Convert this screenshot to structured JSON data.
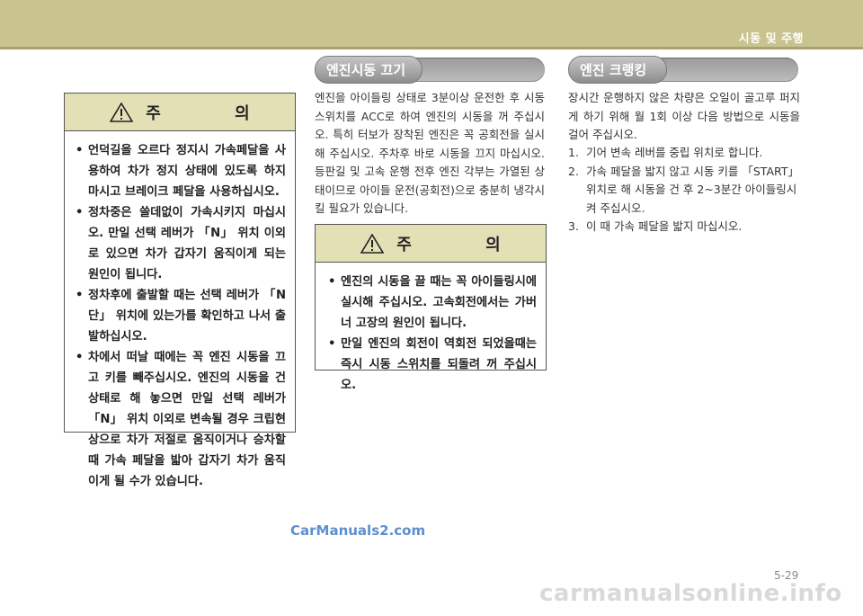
{
  "header": {
    "chapter_title": "시동 및 주행",
    "colors": {
      "band": "#c9c38f",
      "caution_header": "#e3e0b6"
    }
  },
  "left_caution": {
    "icon": "warning-triangle-icon",
    "title": "주 의",
    "items": [
      "언덕길을 오르다 정지시 가속페달을 사용하여 차가 정지 상태에 있도록 하지 마시고 브레이크 페달을 사용하십시오.",
      "정차중은 쓸데없이 가속시키지 마십시오. 만일 선택 레버가 「N」 위치 이외로 있으면 차가 갑자기 움직이게 되는 원인이 됩니다.",
      "정차후에 출발할 때는 선택 레버가 「N단」 위치에 있는가를 확인하고 나서 출발하십시오.",
      "차에서 떠날 때에는 꼭 엔진 시동을 끄고 키를 빼주십시오. 엔진의 시동을 건 상태로 해 놓으면 만일 선택 레버가 「N」 위치 이외로 변속될 경우 크립현상으로 차가 저절로 움직이거나 승차할 때 가속 페달을 밟아 갑자기 차가 움직이게 될 수가 있습니다."
    ]
  },
  "engine_stop": {
    "heading": "엔진시동 끄기",
    "body": "엔진을 아이들링 상태로 3분이상 운전한 후 시동 스위치를 ACC로 하여 엔진의 시동을 꺼 주십시오. 특히 터보가 장착된 엔진은 꼭 공회전을 실시해 주십시오. 주차후 바로 시동을 끄지 마십시오. 등판길 및 고속 운행 전후 엔진 각부는 가열된 상태이므로 아이들 운전(공회전)으로 충분히 냉각시킬 필요가 있습니다.",
    "caution": {
      "icon": "warning-triangle-icon",
      "title": "주 의",
      "items": [
        "엔진의 시동을 끌 때는 꼭 아이들링시에 실시해 주십시오. 고속회전에서는 가버너 고장의 원인이 됩니다.",
        "만일 엔진의 회전이 역회전 되었을때는 즉시 시동 스위치를 되돌려 꺼 주십시오."
      ]
    }
  },
  "engine_cranking": {
    "heading": "엔진 크랭킹",
    "intro": "장시간 운행하지 않은 차량은 오일이 골고루 퍼지게 하기 위해 월 1회 이상 다음 방법으로 시동을 걸어 주십시오.",
    "steps": [
      {
        "num": "1.",
        "text": "기어 변속 레버를 중립 위치로 합니다."
      },
      {
        "num": "2.",
        "text": "가속 페달을 밟지 않고 시동 키를 「START」위치로 해 시동을 건 후 2~3분간 아이들링시켜 주십시오."
      },
      {
        "num": "3.",
        "text": "이 때 가속 페달을 밟지 마십시오."
      }
    ]
  },
  "watermarks": {
    "site1": "CarManuals2.com",
    "site2": "carmanualsonline.info"
  },
  "footer": {
    "page_number": "5-29"
  }
}
